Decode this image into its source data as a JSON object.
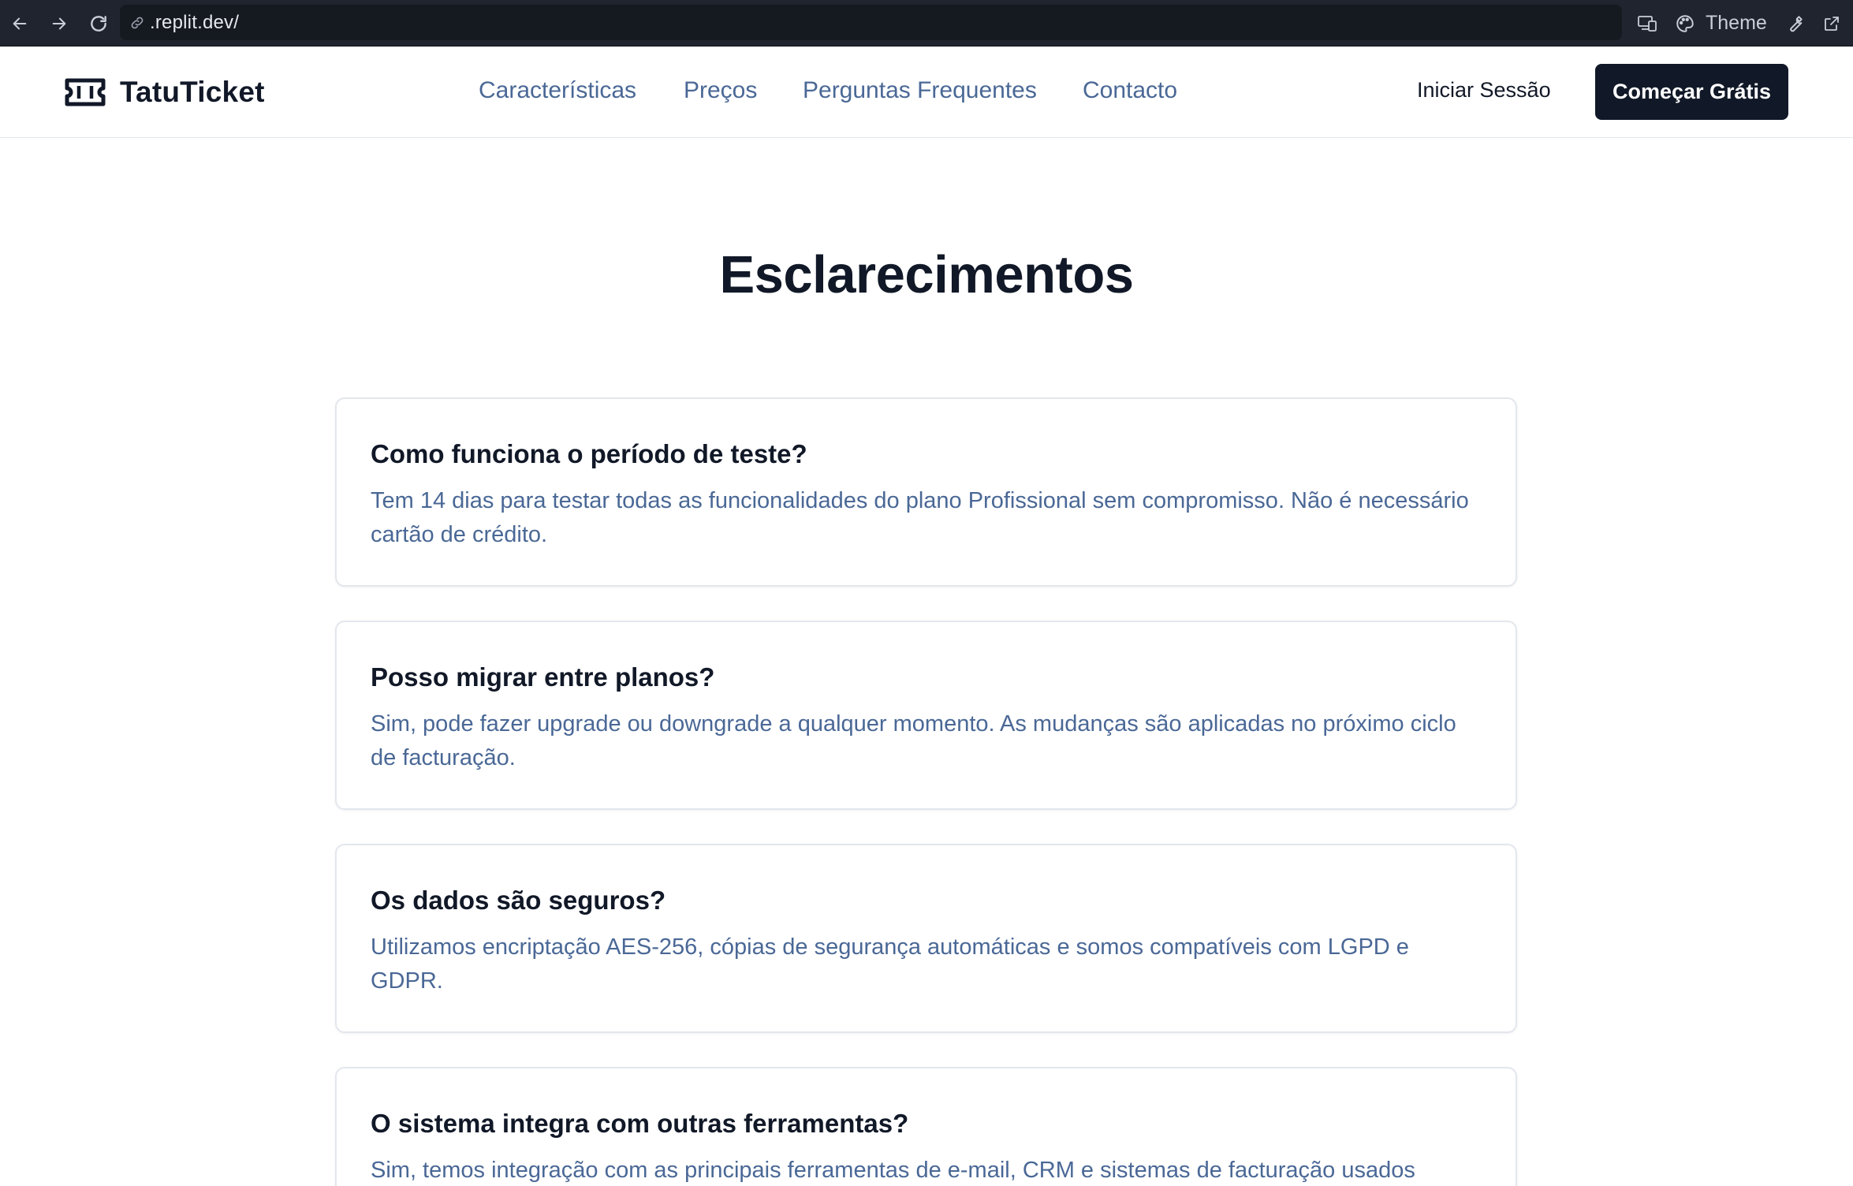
{
  "browser": {
    "url": ".replit.dev/",
    "theme_label": "Theme"
  },
  "header": {
    "brand_name": "TatuTicket",
    "nav": [
      {
        "label": "Características"
      },
      {
        "label": "Preços"
      },
      {
        "label": "Perguntas Frequentes"
      },
      {
        "label": "Contacto"
      }
    ],
    "login_label": "Iniciar Sessão",
    "cta_label": "Começar Grátis"
  },
  "faq": {
    "title": "Esclarecimentos",
    "items": [
      {
        "question": "Como funciona o período de teste?",
        "answer": "Tem 14 dias para testar todas as funcionalidades do plano Profissional sem compromisso. Não é necessário cartão de crédito."
      },
      {
        "question": "Posso migrar entre planos?",
        "answer": "Sim, pode fazer upgrade ou downgrade a qualquer momento. As mudanças são aplicadas no próximo ciclo de facturação."
      },
      {
        "question": "Os dados são seguros?",
        "answer": "Utilizamos encriptação AES-256, cópias de segurança automáticas e somos compatíveis com LGPD e GDPR."
      },
      {
        "question": "O sistema integra com outras ferramentas?",
        "answer": "Sim, temos integração com as principais ferramentas de e-mail, CRM e sistemas de facturação usados"
      }
    ]
  },
  "colors": {
    "chrome_bg": "#1f242e",
    "text_primary": "#111827",
    "link_blue": "#4a6896",
    "cta_bg": "#111827",
    "border": "#e3e7ed"
  },
  "icons": {
    "back": "arrow-left-icon",
    "forward": "arrow-right-icon",
    "reload": "reload-icon",
    "link": "link-icon",
    "devices": "devices-icon",
    "palette": "palette-icon",
    "wrench": "wrench-icon",
    "external": "external-link-icon",
    "logo": "ticket-logo-icon"
  }
}
